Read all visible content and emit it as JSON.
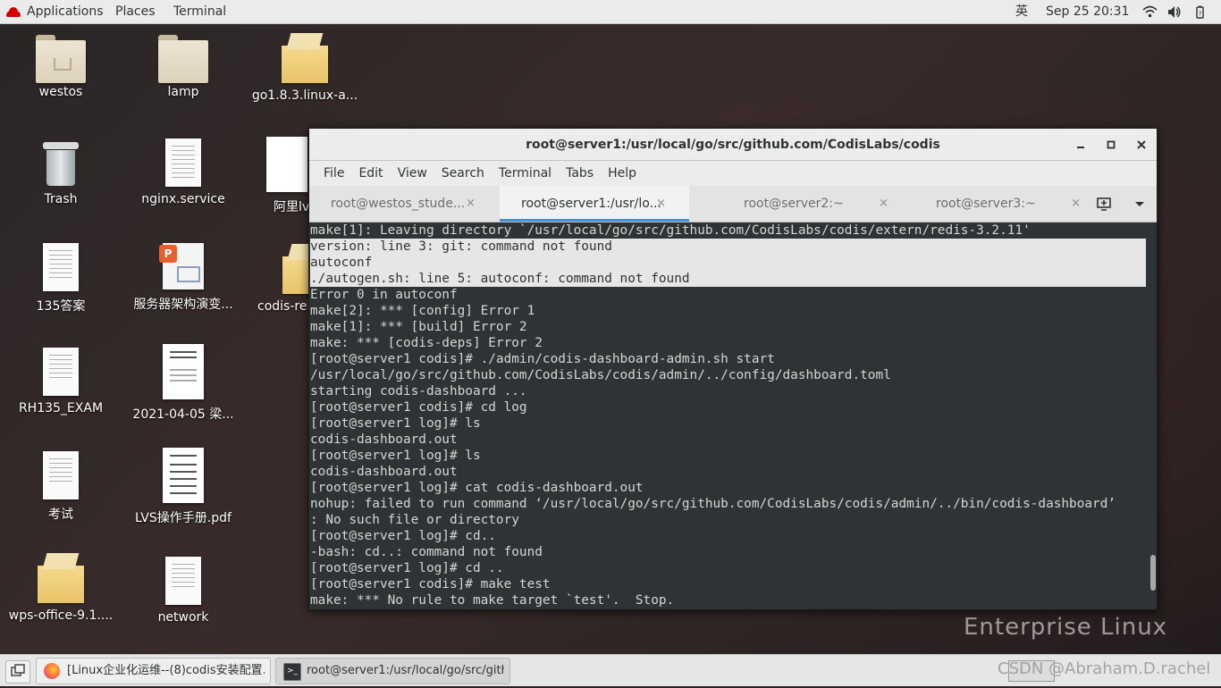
{
  "topbar": {
    "applications": "Applications",
    "places": "Places",
    "terminal": "Terminal",
    "ime": "英",
    "clock": "Sep 25  20:31"
  },
  "desktop_icons": [
    {
      "label": "westos",
      "type": "home-folder"
    },
    {
      "label": "lamp",
      "type": "folder"
    },
    {
      "label": "go1.8.3.linux-a...",
      "type": "archive"
    },
    {
      "label": "Trash",
      "type": "trash"
    },
    {
      "label": "nginx.service",
      "type": "text-file"
    },
    {
      "label": "阿里lv",
      "type": "image"
    },
    {
      "label": "135答案",
      "type": "text-file"
    },
    {
      "label": "服务器架构演变...",
      "type": "wps-presentation"
    },
    {
      "label": "codis-rel",
      "type": "archive"
    },
    {
      "label": "RH135_EXAM",
      "type": "text-file"
    },
    {
      "label": "2021-04-05  梁...",
      "type": "document"
    },
    {
      "label": "考试",
      "type": "text-file"
    },
    {
      "label": "LVS操作手册.pdf",
      "type": "pdf"
    },
    {
      "label": "wps-office-9.1....",
      "type": "archive"
    },
    {
      "label": "network",
      "type": "text-file"
    }
  ],
  "terminal": {
    "title": "root@server1:/usr/local/go/src/github.com/CodisLabs/codis",
    "menu": [
      "File",
      "Edit",
      "View",
      "Search",
      "Terminal",
      "Tabs",
      "Help"
    ],
    "tabs": [
      {
        "label": "root@westos_stude...",
        "active": false
      },
      {
        "label": "root@server1:/usr/lo...",
        "active": true
      },
      {
        "label": "root@server2:~",
        "active": false
      },
      {
        "label": "root@server3:~",
        "active": false
      }
    ],
    "close_glyph": "×",
    "lines": [
      "make[1]: Leaving directory `/usr/local/go/src/github.com/CodisLabs/codis/extern/redis-3.2.11'",
      "version: line 3: git: command not found",
      "autoconf",
      "./autogen.sh: line 5: autoconf: command not found",
      "Error 0 in autoconf",
      "make[2]: *** [config] Error 1",
      "make[1]: *** [build] Error 2",
      "make: *** [codis-deps] Error 2",
      "[root@server1 codis]# ./admin/codis-dashboard-admin.sh start",
      "/usr/local/go/src/github.com/CodisLabs/codis/admin/../config/dashboard.toml",
      "starting codis-dashboard ...",
      "[root@server1 codis]# cd log",
      "[root@server1 log]# ls",
      "codis-dashboard.out",
      "[root@server1 log]# ls",
      "codis-dashboard.out",
      "[root@server1 log]# cat codis-dashboard.out",
      "nohup: failed to run command ‘/usr/local/go/src/github.com/CodisLabs/codis/admin/../bin/codis-dashboard’",
      ": No such file or directory",
      "[root@server1 log]# cd..",
      "-bash: cd..: command not found",
      "[root@server1 log]# cd ..",
      "[root@server1 codis]# make test",
      "make: *** No rule to make target `test'.  Stop."
    ],
    "selected_line_indices": [
      1,
      2,
      3
    ]
  },
  "taskbar": {
    "tasks": [
      {
        "label": "[Linux企业化运维--(8)codis安装配置...",
        "icon": "firefox-icon"
      },
      {
        "label": "root@server1:/usr/local/go/src/gith...",
        "icon": "terminal-icon"
      }
    ],
    "watermark": "CSDN @Abraham.D.rachel"
  },
  "background_text": "Enterprise Linux",
  "colors": {
    "accent": "#4a90d9",
    "terminal_bg": "#2e3436",
    "terminal_fg": "#d3d7cf",
    "selection_bg": "#e6e6e6"
  }
}
